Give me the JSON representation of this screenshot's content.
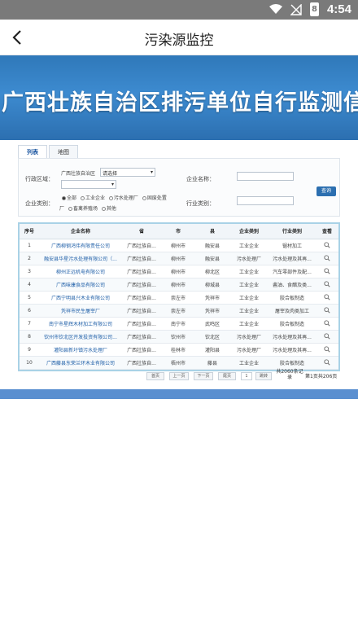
{
  "status": {
    "time": "4:54",
    "battery": "8"
  },
  "header": {
    "title": "污染源监控"
  },
  "banner": {
    "text": "广西壮族自治区排污单位自行监测信"
  },
  "tabs": [
    {
      "label": "列表"
    },
    {
      "label": "地图"
    }
  ],
  "form": {
    "region_label": "行政区域：",
    "region_value": "广西壮族自治区",
    "region_select": "请选择",
    "company_name_label": "企业名称：",
    "company_type_label": "企业类别：",
    "type_options": [
      "全部",
      "工业企业",
      "污水处理厂",
      "固废处置"
    ],
    "type_options_2": [
      "厂",
      "畜禽养殖场",
      "其他"
    ],
    "industry_label": "行业类别：",
    "query_button": "查询"
  },
  "table": {
    "headers": [
      "序号",
      "企业名称",
      "省",
      "市",
      "县",
      "企业类别",
      "行业类别",
      "查看"
    ],
    "rows": [
      [
        "1",
        "广西柳钢鸿伟有限责任公司",
        "广西壮族自...",
        "柳州市",
        "融安县",
        "工业企业",
        "锯材加工"
      ],
      [
        "2",
        "融安县华星污水处理有限公司（...",
        "广西壮族自...",
        "柳州市",
        "融安县",
        "污水处理厂",
        "污水处理及其再..."
      ],
      [
        "3",
        "柳州正远机电有限公司",
        "广西壮族自...",
        "柳州市",
        "柳北区",
        "工业企业",
        "汽车零部件及配..."
      ],
      [
        "4",
        "广西味康食品有限公司",
        "广西壮族自...",
        "柳州市",
        "柳城县",
        "工业企业",
        "酱油、食醋及类..."
      ],
      [
        "5",
        "广西宁明县兴木业有限公司",
        "广西壮族自...",
        "崇左市",
        "凭祥市",
        "工业企业",
        "胶合板制造"
      ],
      [
        "6",
        "凭祥市民生屠宰厂",
        "广西壮族自...",
        "崇左市",
        "凭祥市",
        "工业企业",
        "屠宰及肉类加工"
      ],
      [
        "7",
        "南宁市星辉木材加工有限公司",
        "广西壮族自...",
        "南宁市",
        "武鸣区",
        "工业企业",
        "胶合板制造"
      ],
      [
        "8",
        "钦州市钦北区开发投资有限公司...",
        "广西壮族自...",
        "钦州市",
        "钦北区",
        "污水处理厂",
        "污水处理及其再..."
      ],
      [
        "9",
        "灌阳县新圩镇污水处理厂",
        "广西壮族自...",
        "桂林市",
        "灌阳县",
        "污水处理厂",
        "污水处理及其再..."
      ],
      [
        "10",
        "广西藤县东荣兰环木业有限公司",
        "广西壮族自...",
        "梧州市",
        "藤县",
        "工业企业",
        "胶合板制造"
      ]
    ]
  },
  "pager": {
    "first": "首页",
    "prev": "上一页",
    "next": "下一页",
    "last": "尾页",
    "page_input": "1",
    "go": "跳转",
    "total_records": "共2060条记录",
    "page_info": "第1页共206页"
  },
  "colors": {
    "banner": "#2f78b9",
    "link": "#1f5fa8",
    "accent": "#2c6fb0"
  }
}
